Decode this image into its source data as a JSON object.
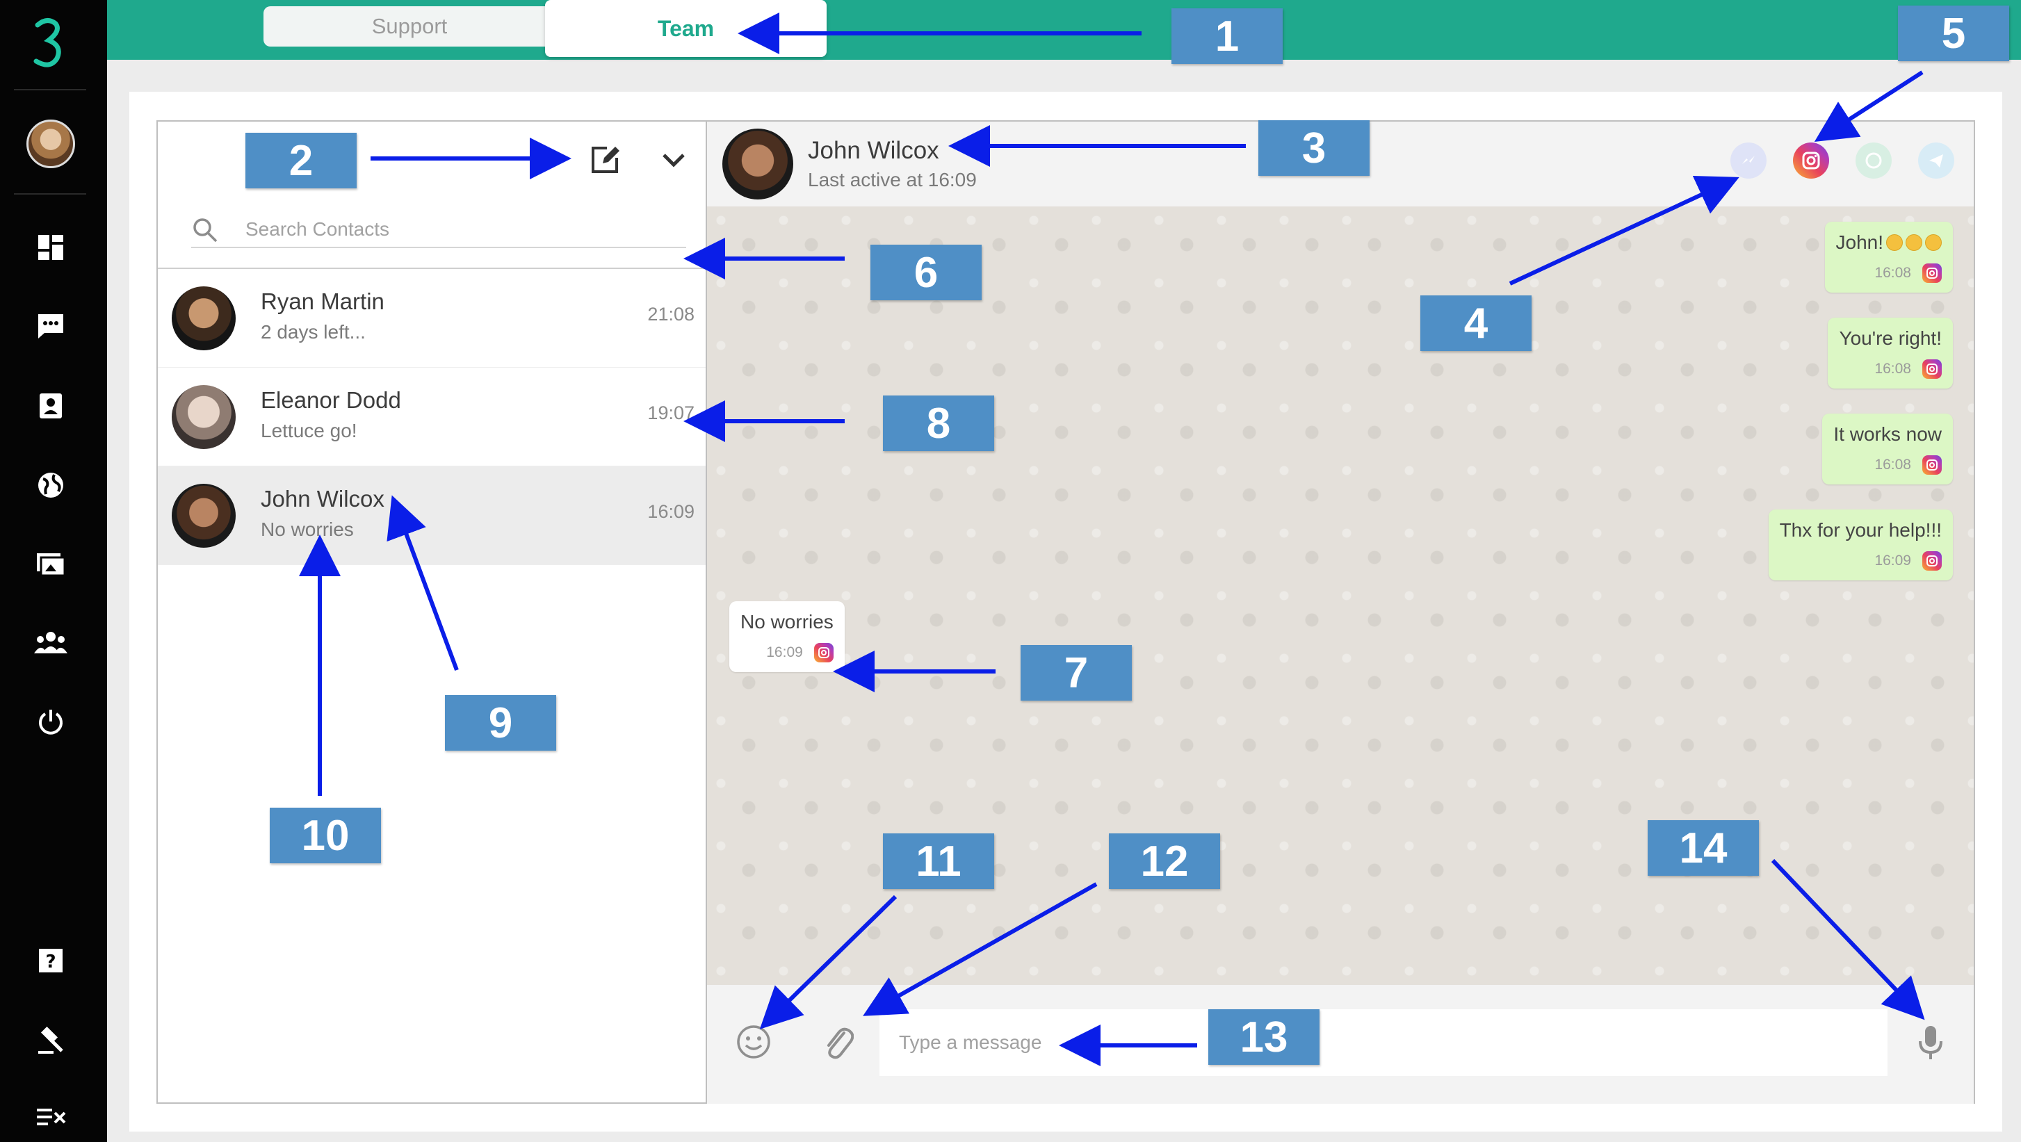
{
  "tabs": {
    "support": "Support",
    "team": "Team"
  },
  "rail": {
    "icons": [
      "logo-icon",
      "dashboard-icon",
      "chat-icon",
      "contacts-icon",
      "globe-icon",
      "media-icon",
      "team-icon",
      "power-icon",
      "help-icon",
      "gavel-icon",
      "tasks-icon"
    ]
  },
  "contacts": {
    "search_placeholder": "Search Contacts",
    "items": [
      {
        "name": "Ryan Martin",
        "preview": "2 days left...",
        "time": "21:08"
      },
      {
        "name": "Eleanor Dodd",
        "preview": "Lettuce go!",
        "time": "19:07"
      },
      {
        "name": "John Wilcox",
        "preview": "No worries",
        "time": "16:09"
      }
    ]
  },
  "chat": {
    "name": "John Wilcox",
    "status": "Last active at 16:09",
    "channels": [
      "messenger-icon",
      "instagram-icon",
      "whatsapp-icon",
      "telegram-icon"
    ],
    "messages": [
      {
        "text": "John!",
        "time": "16:08",
        "dir": "out"
      },
      {
        "text": "You're right!",
        "time": "16:08",
        "dir": "out"
      },
      {
        "text": "It works now",
        "time": "16:08",
        "dir": "out"
      },
      {
        "text": "Thx for your help!!!",
        "time": "16:09",
        "dir": "out"
      },
      {
        "text": "No worries",
        "time": "16:09",
        "dir": "in"
      }
    ],
    "input_placeholder": "Type a message"
  },
  "colors": {
    "brand": "#1fa98d",
    "annotation": "#4f8fc6",
    "arrow": "#0a1ee8",
    "outgoing_bubble": "#dcf7c5"
  },
  "annotations": [
    "1",
    "2",
    "3",
    "4",
    "5",
    "6",
    "7",
    "8",
    "9",
    "10",
    "11",
    "12",
    "13",
    "14"
  ]
}
